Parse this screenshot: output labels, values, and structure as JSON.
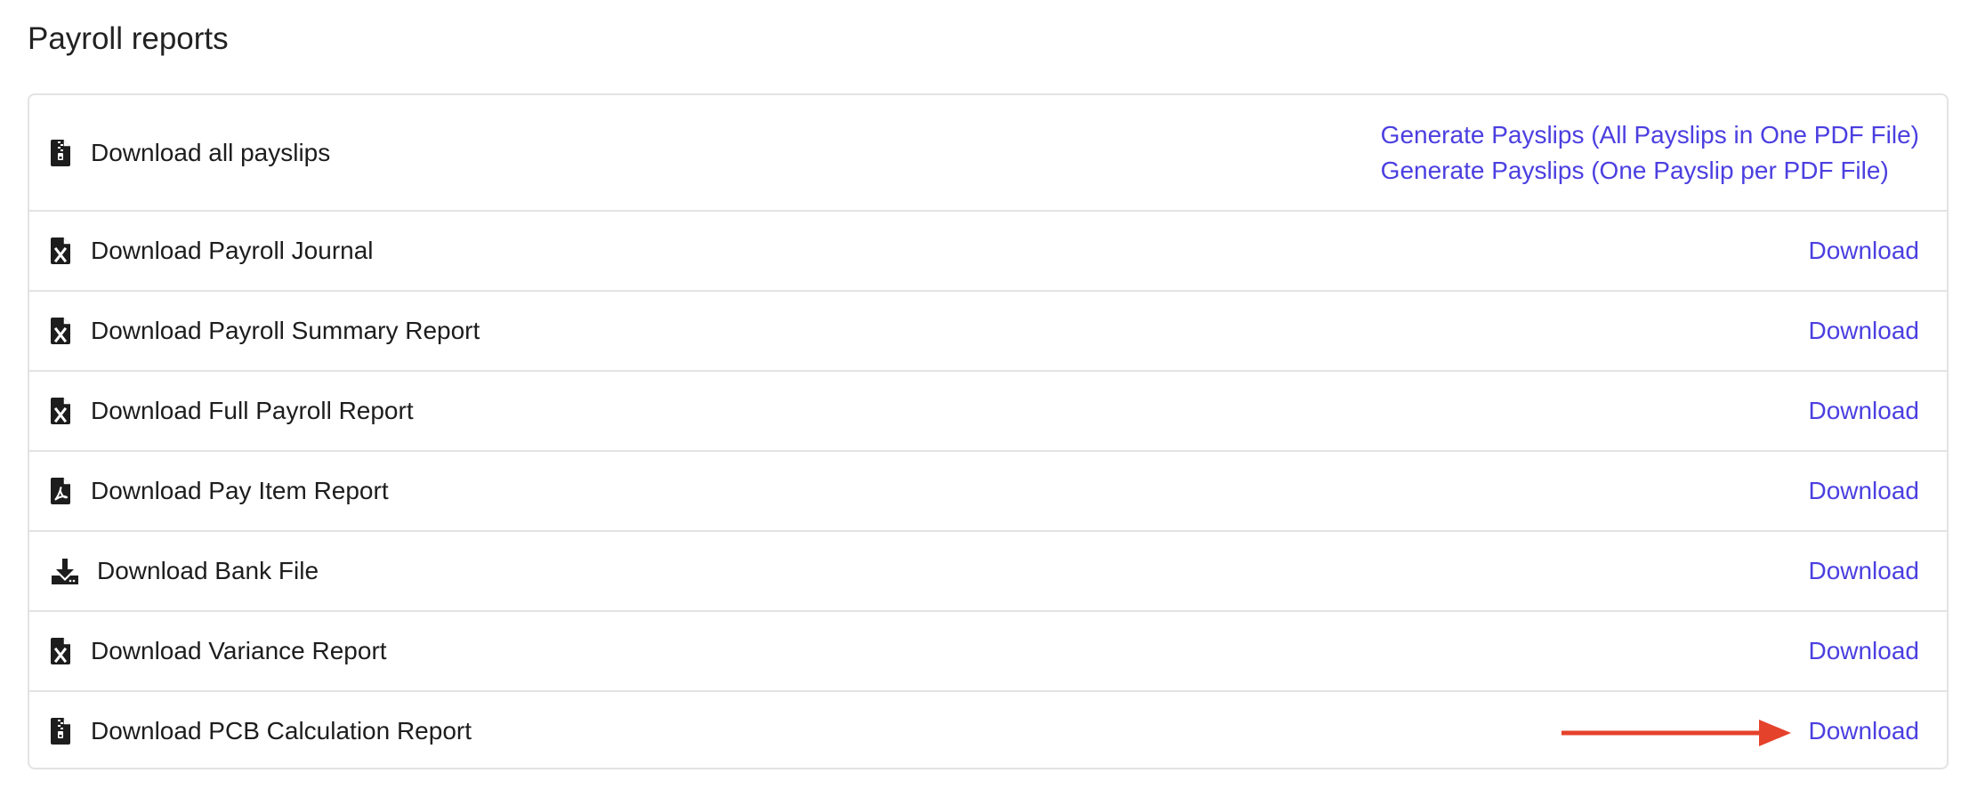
{
  "page": {
    "title": "Payroll reports"
  },
  "rows": [
    {
      "label": "Download all payslips",
      "icon": "zip-file-icon",
      "links": [
        "Generate Payslips (All Payslips in One PDF File)",
        "Generate Payslips (One Payslip per PDF File)"
      ]
    },
    {
      "label": "Download Payroll Journal",
      "icon": "excel-file-icon",
      "action": "Download"
    },
    {
      "label": "Download Payroll Summary Report",
      "icon": "excel-file-icon",
      "action": "Download"
    },
    {
      "label": "Download Full Payroll Report",
      "icon": "excel-file-icon",
      "action": "Download"
    },
    {
      "label": "Download Pay Item Report",
      "icon": "pdf-file-icon",
      "action": "Download"
    },
    {
      "label": "Download Bank File",
      "icon": "download-tray-icon",
      "action": "Download"
    },
    {
      "label": "Download Variance Report",
      "icon": "excel-file-icon",
      "action": "Download"
    },
    {
      "label": "Download PCB Calculation Report",
      "icon": "zip-file-icon",
      "action": "Download"
    }
  ],
  "colors": {
    "link": "#4b3fe0",
    "arrow": "#e5422b",
    "border": "#e3e3e3"
  }
}
